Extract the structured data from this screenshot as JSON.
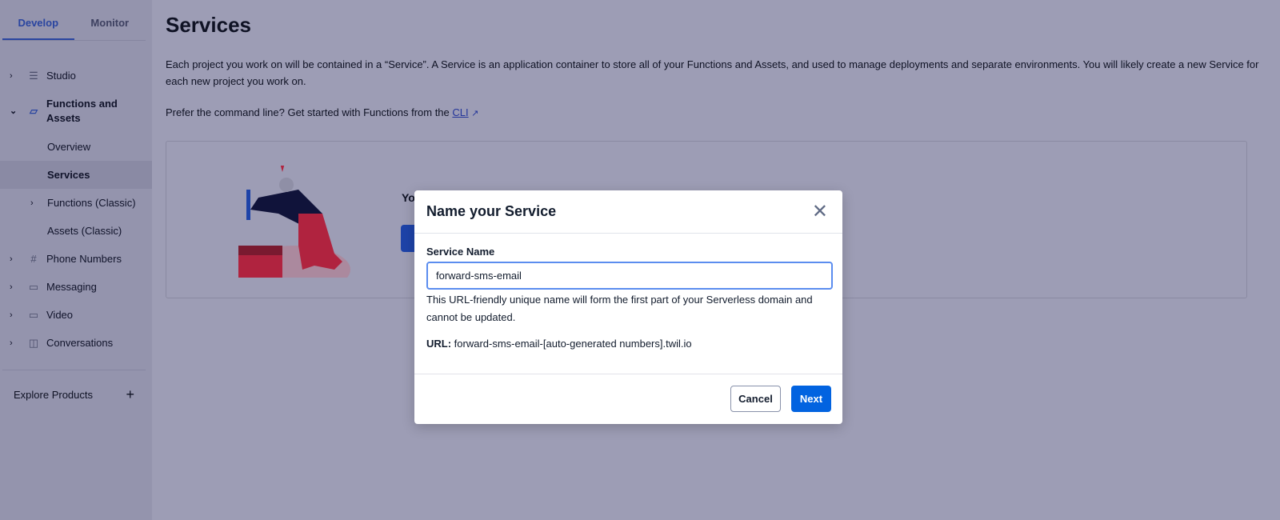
{
  "sidebar": {
    "tabs": [
      {
        "label": "Develop",
        "active": true
      },
      {
        "label": "Monitor",
        "active": false
      }
    ],
    "items": [
      {
        "label": "Studio",
        "icon": "studio-icon"
      },
      {
        "label": "Functions and Assets",
        "icon": "functions-icon",
        "expanded": true
      },
      {
        "label": "Overview"
      },
      {
        "label": "Services",
        "selected": true
      },
      {
        "label": "Functions (Classic)"
      },
      {
        "label": "Assets (Classic)"
      },
      {
        "label": "Phone Numbers",
        "icon": "hash-icon"
      },
      {
        "label": "Messaging",
        "icon": "message-icon"
      },
      {
        "label": "Video",
        "icon": "video-icon"
      },
      {
        "label": "Conversations",
        "icon": "conversations-icon"
      }
    ],
    "explore": "Explore Products"
  },
  "main": {
    "title": "Services",
    "description": "Each project you work on will be contained in a “Service”. A Service is an application container to store all of your Functions and Assets, and used to manage deployments and separate environments. You will likely create a new Service for each new project you work on.",
    "cli_prefix": "Prefer the command line? Get started with Functions from the ",
    "cli_link": "CLI",
    "card_heading_partial": "Yo"
  },
  "modal": {
    "title": "Name your Service",
    "field_label": "Service Name",
    "field_value": "forward-sms-email",
    "help": "This URL-friendly unique name will form the first part of your Serverless domain and cannot be updated.",
    "url_label": "URL:",
    "url_value": " forward-sms-email-[auto-generated numbers].twil.io",
    "cancel": "Cancel",
    "next": "Next"
  },
  "colors": {
    "accent": "#0263e0",
    "focus": "#5b8def"
  }
}
